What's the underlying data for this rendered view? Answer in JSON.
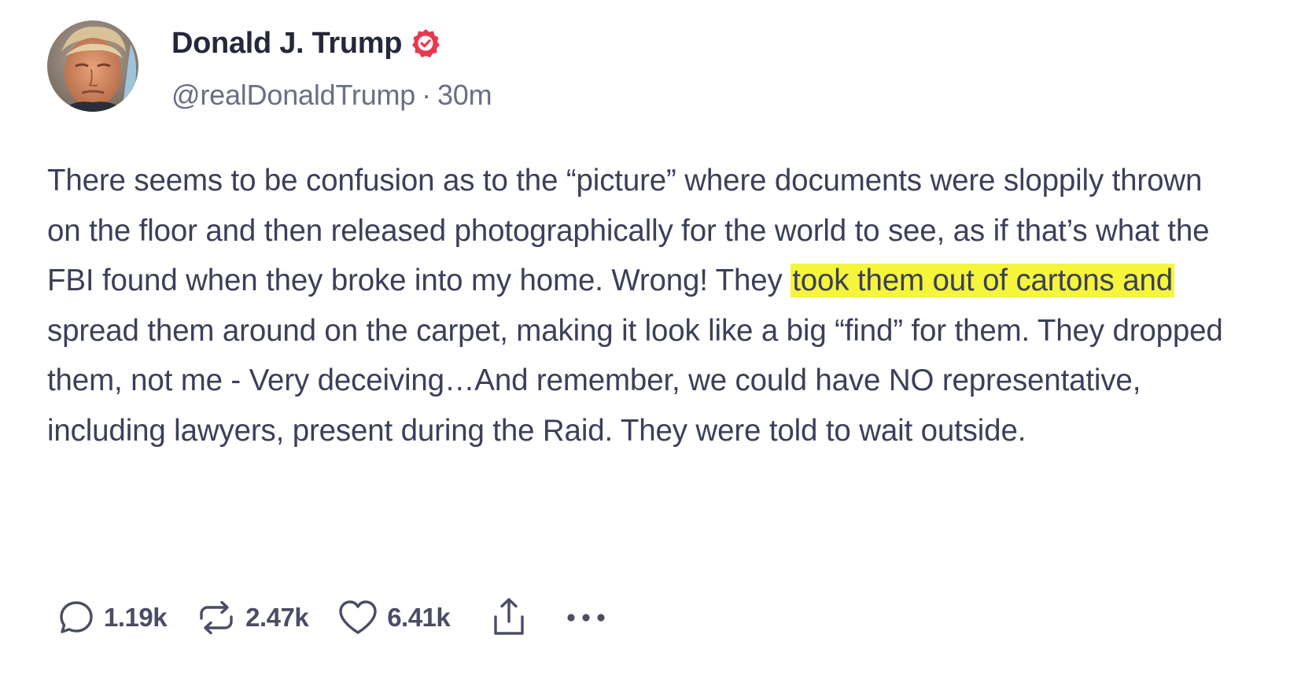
{
  "author": {
    "display_name": "Donald J. Trump",
    "handle": "@realDonaldTrump",
    "separator": "·",
    "time_ago": "30m",
    "verified_color": "#e8384f"
  },
  "post": {
    "text_before": "There seems to be confusion as to the “picture” where documents were sloppily thrown on the floor and then released photographically for the world to see, as if that’s what the FBI found when they broke into my home. Wrong! They ",
    "text_highlighted": "took them out of cartons and",
    "text_after": " spread them around on the carpet, making it look like a big “find” for them. They dropped them, not me - Very deceiving…And remember, we could have NO representative, including lawyers, present during the Raid. They were told to wait outside.",
    "highlight_color": "#f5f53c"
  },
  "actions": {
    "replies": "1.19k",
    "reposts": "2.47k",
    "likes": "6.41k",
    "icons": [
      "reply-icon",
      "repost-icon",
      "like-icon",
      "share-icon",
      "more-icon"
    ]
  }
}
